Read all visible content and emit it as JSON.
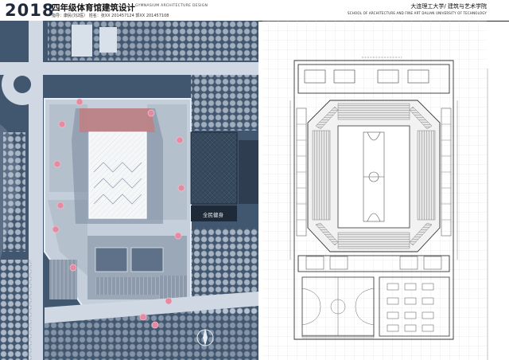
{
  "header": {
    "year": "2018",
    "course_title": "四年级体育馆建筑设计",
    "course_en": "GYMNASIUM ARCHITECTURE DESIGN",
    "info": "指导：康民(刘2医）  姓名：张XX 201457124  郭XX 201457108",
    "school_cn": "大连理工大学/ 建筑与艺术学院",
    "school_en": "SCHOOL OF ARCHITECTURE AND FINE ART DALIAN UNIVERSITY OF TECHNOLOGY"
  },
  "site_plan": {
    "sign_text": "全民健身",
    "colors": {
      "background": "#41566f",
      "road": "#cfd8e3",
      "tree": "#d8e0ea",
      "accent": "#e58aa0",
      "roof": "#ffffff"
    }
  },
  "floor_plan": {
    "colors": {
      "line": "#333333",
      "seating": "#9a9a9a",
      "grid": "#d9d9d9"
    }
  }
}
